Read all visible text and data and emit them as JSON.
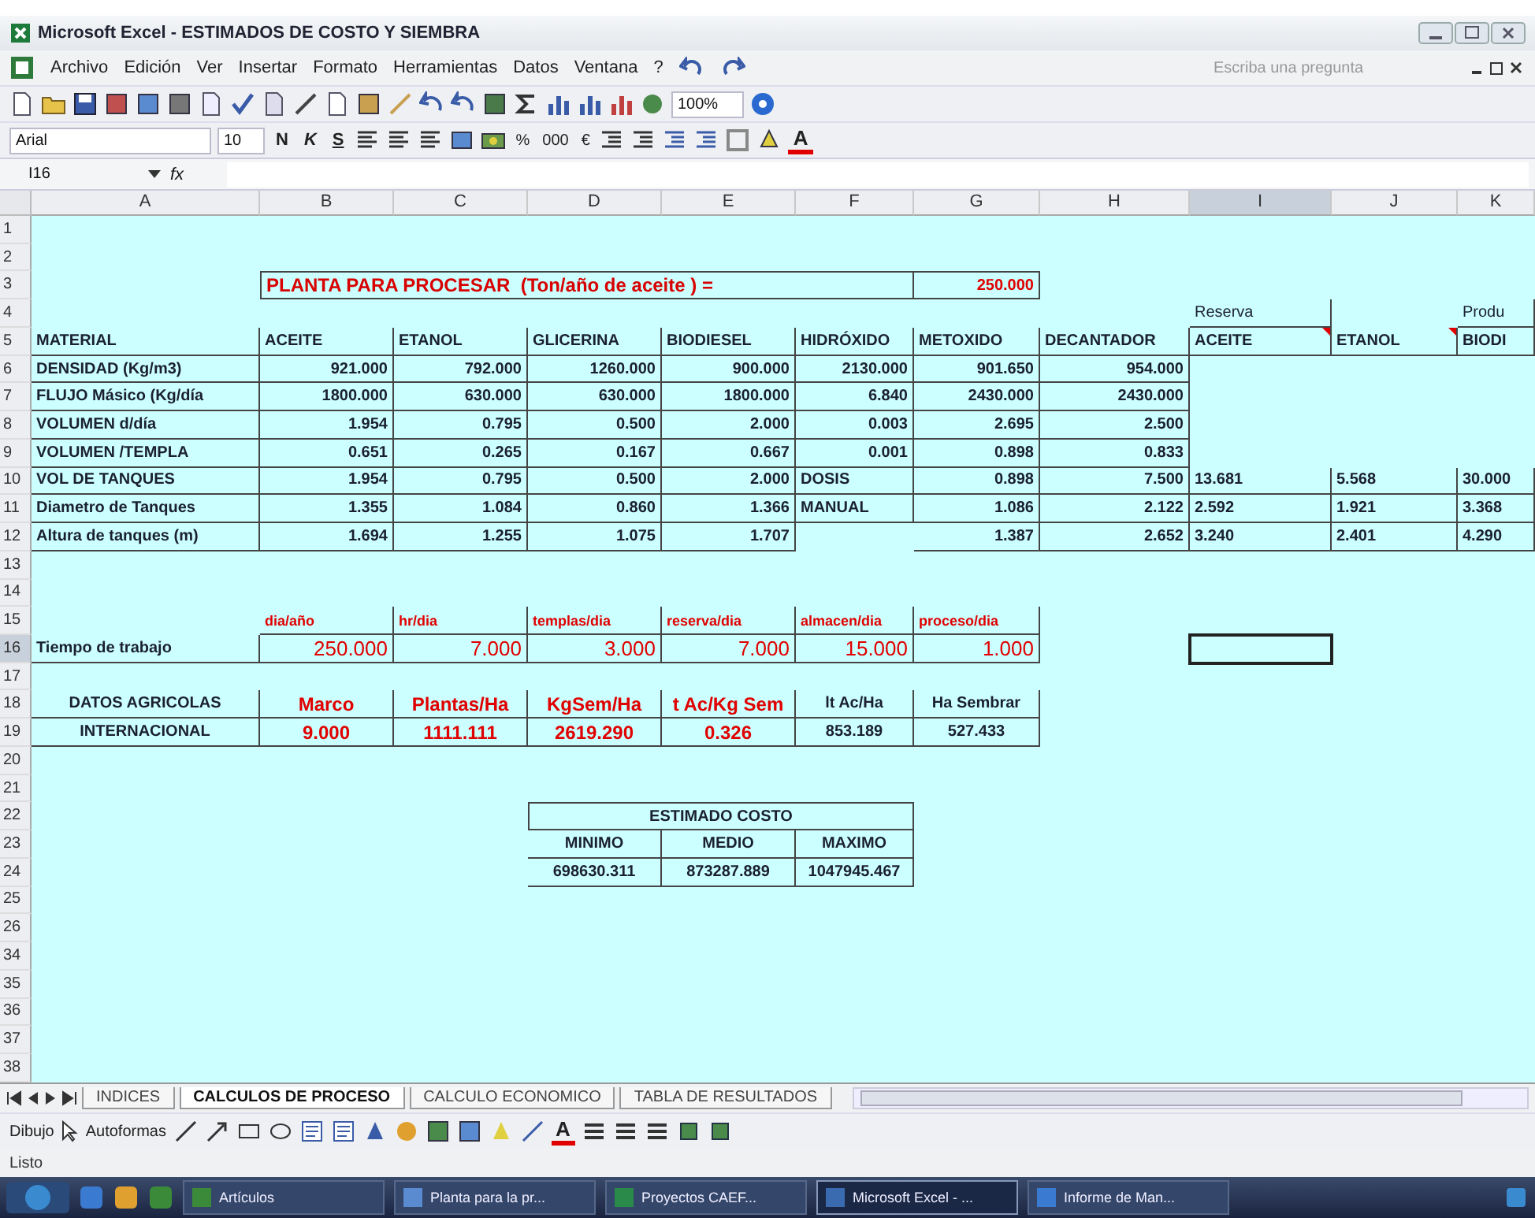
{
  "window": {
    "title": "Microsoft Excel - ESTIMADOS DE COSTO Y SIEMBRA"
  },
  "menu": [
    {
      "label": "Archivo"
    },
    {
      "label": "Edición"
    },
    {
      "label": "Ver"
    },
    {
      "label": "Insertar"
    },
    {
      "label": "Formato"
    },
    {
      "label": "Herramientas"
    },
    {
      "label": "Datos"
    },
    {
      "label": "Ventana"
    },
    {
      "label": "?"
    }
  ],
  "help_box": {
    "placeholder": "Escriba una pregunta"
  },
  "standard_toolbar": {
    "zoom": "100%"
  },
  "formatting_toolbar": {
    "font": "Arial",
    "size": "10",
    "buttons": [
      {
        "label": "N",
        "kind": "bold"
      },
      {
        "label": "K",
        "kind": "italic"
      },
      {
        "label": "S",
        "kind": "underline"
      }
    ],
    "number_buttons": [
      "%",
      "000",
      "€"
    ],
    "font_color": "A"
  },
  "formula_bar": {
    "name_box": "I16",
    "fx": "fx"
  },
  "sheet": {
    "columns": [
      {
        "label": "A",
        "selected": false
      },
      {
        "label": "B",
        "selected": false
      },
      {
        "label": "C",
        "selected": false
      },
      {
        "label": "D",
        "selected": false
      },
      {
        "label": "E",
        "selected": false
      },
      {
        "label": "F",
        "selected": false
      },
      {
        "label": "G",
        "selected": false
      },
      {
        "label": "H",
        "selected": false
      },
      {
        "label": "I",
        "selected": true
      },
      {
        "label": "J",
        "selected": false
      },
      {
        "label": "K",
        "selected": false
      }
    ],
    "rows": [
      {
        "number": "1",
        "selected": false,
        "cells": []
      },
      {
        "number": "2",
        "selected": false,
        "cells": []
      },
      {
        "number": "3",
        "selected": false,
        "cells": [
          {},
          {
            "text": "PLANTA PARA PROCESAR  (Ton/año de aceite ) =",
            "kind": "title"
          },
          {},
          {},
          {},
          {},
          {
            "text": "250.000",
            "kind": "red-small-number"
          }
        ]
      },
      {
        "number": "4",
        "selected": false,
        "cells": [
          {},
          {},
          {},
          {},
          {},
          {},
          {},
          {},
          {
            "text": "Reserva",
            "kind": "plain"
          },
          {},
          {
            "text": "Produ",
            "kind": "plain"
          }
        ]
      },
      {
        "number": "5",
        "selected": false,
        "cells": [
          {
            "text": "MATERIAL",
            "kind": "label"
          },
          {
            "text": "ACEITE",
            "kind": "label"
          },
          {
            "text": "ETANOL",
            "kind": "label"
          },
          {
            "text": "GLICERINA",
            "kind": "label"
          },
          {
            "text": "BIODIESEL",
            "kind": "label"
          },
          {
            "text": "HIDRÓXIDO",
            "kind": "label"
          },
          {
            "text": "METOXIDO",
            "kind": "label"
          },
          {
            "text": "DECANTADOR",
            "kind": "label"
          },
          {
            "text": "ACEITE",
            "kind": "label",
            "comment": true
          },
          {
            "text": "ETANOL",
            "kind": "label",
            "comment": true
          },
          {
            "text": "BIODI",
            "kind": "label"
          }
        ]
      },
      {
        "number": "6",
        "selected": false,
        "cells": [
          {
            "text": "DENSIDAD (Kg/m3)",
            "kind": "label"
          },
          {
            "text": "921.000",
            "kind": "number"
          },
          {
            "text": "792.000",
            "kind": "number"
          },
          {
            "text": "1260.000",
            "kind": "number"
          },
          {
            "text": "900.000",
            "kind": "number"
          },
          {
            "text": "2130.000",
            "kind": "number"
          },
          {
            "text": "901.650",
            "kind": "number"
          },
          {
            "text": "954.000",
            "kind": "number"
          }
        ]
      },
      {
        "number": "7",
        "selected": false,
        "cells": [
          {
            "text": "FLUJO Másico (Kg/día",
            "kind": "label"
          },
          {
            "text": "1800.000",
            "kind": "number"
          },
          {
            "text": "630.000",
            "kind": "number"
          },
          {
            "text": "630.000",
            "kind": "number"
          },
          {
            "text": "1800.000",
            "kind": "number"
          },
          {
            "text": "6.840",
            "kind": "number"
          },
          {
            "text": "2430.000",
            "kind": "number"
          },
          {
            "text": "2430.000",
            "kind": "number"
          }
        ]
      },
      {
        "number": "8",
        "selected": false,
        "cells": [
          {
            "text": "VOLUMEN d/día",
            "kind": "label"
          },
          {
            "text": "1.954",
            "kind": "number"
          },
          {
            "text": "0.795",
            "kind": "number"
          },
          {
            "text": "0.500",
            "kind": "number"
          },
          {
            "text": "2.000",
            "kind": "number"
          },
          {
            "text": "0.003",
            "kind": "number"
          },
          {
            "text": "2.695",
            "kind": "number"
          },
          {
            "text": "2.500",
            "kind": "number"
          }
        ]
      },
      {
        "number": "9",
        "selected": false,
        "cells": [
          {
            "text": "VOLUMEN /TEMPLA",
            "kind": "label"
          },
          {
            "text": "0.651",
            "kind": "number"
          },
          {
            "text": "0.265",
            "kind": "number"
          },
          {
            "text": "0.167",
            "kind": "number"
          },
          {
            "text": "0.667",
            "kind": "number"
          },
          {
            "text": "0.001",
            "kind": "number"
          },
          {
            "text": "0.898",
            "kind": "number"
          },
          {
            "text": "0.833",
            "kind": "number"
          }
        ]
      },
      {
        "number": "10",
        "selected": false,
        "cells": [
          {
            "text": "VOL DE TANQUES",
            "kind": "label"
          },
          {
            "text": "1.954",
            "kind": "number"
          },
          {
            "text": "0.795",
            "kind": "number"
          },
          {
            "text": "0.500",
            "kind": "number"
          },
          {
            "text": "2.000",
            "kind": "number"
          },
          {
            "text": "DOSIS",
            "kind": "label"
          },
          {
            "text": "0.898",
            "kind": "number"
          },
          {
            "text": "7.500",
            "kind": "number"
          },
          {
            "text": "13.681",
            "kind": "label"
          },
          {
            "text": "5.568",
            "kind": "label"
          },
          {
            "text": "30.000",
            "kind": "label"
          }
        ]
      },
      {
        "number": "11",
        "selected": false,
        "cells": [
          {
            "text": "Diametro de Tanques",
            "kind": "label"
          },
          {
            "text": "1.355",
            "kind": "number"
          },
          {
            "text": "1.084",
            "kind": "number"
          },
          {
            "text": "0.860",
            "kind": "number"
          },
          {
            "text": "1.366",
            "kind": "number"
          },
          {
            "text": "MANUAL",
            "kind": "label"
          },
          {
            "text": "1.086",
            "kind": "number"
          },
          {
            "text": "2.122",
            "kind": "number"
          },
          {
            "text": "2.592",
            "kind": "label"
          },
          {
            "text": "1.921",
            "kind": "label"
          },
          {
            "text": "3.368",
            "kind": "label"
          }
        ]
      },
      {
        "number": "12",
        "selected": false,
        "cells": [
          {
            "text": "Altura de tanques (m)",
            "kind": "label"
          },
          {
            "text": "1.694",
            "kind": "number"
          },
          {
            "text": "1.255",
            "kind": "number"
          },
          {
            "text": "1.075",
            "kind": "number"
          },
          {
            "text": "1.707",
            "kind": "number"
          },
          {},
          {
            "text": "1.387",
            "kind": "number"
          },
          {
            "text": "2.652",
            "kind": "number"
          },
          {
            "text": "3.240",
            "kind": "label"
          },
          {
            "text": "2.401",
            "kind": "label"
          },
          {
            "text": "4.290",
            "kind": "label"
          }
        ]
      },
      {
        "number": "13",
        "selected": false,
        "cells": []
      },
      {
        "number": "14",
        "selected": false,
        "cells": []
      },
      {
        "number": "15",
        "selected": false,
        "cells": [
          {},
          {
            "text": "dia/año",
            "kind": "red-small"
          },
          {
            "text": "hr/dia",
            "kind": "red-small"
          },
          {
            "text": "templas/dia",
            "kind": "red-small"
          },
          {
            "text": "reserva/dia",
            "kind": "red-small"
          },
          {
            "text": "almacen/dia",
            "kind": "red-small"
          },
          {
            "text": "proceso/dia",
            "kind": "red-small"
          }
        ]
      },
      {
        "number": "16",
        "selected": true,
        "cells": [
          {
            "text": "Tiempo de trabajo",
            "kind": "label"
          },
          {
            "text": "250.000",
            "kind": "red-number"
          },
          {
            "text": "7.000",
            "kind": "red-number"
          },
          {
            "text": "3.000",
            "kind": "red-number"
          },
          {
            "text": "7.000",
            "kind": "red-number"
          },
          {
            "text": "15.000",
            "kind": "red-number"
          },
          {
            "text": "1.000",
            "kind": "red-number"
          }
        ]
      },
      {
        "number": "17",
        "selected": false,
        "cells": []
      },
      {
        "number": "18",
        "selected": false,
        "cells": [
          {
            "text": "DATOS AGRICOLAS",
            "kind": "center"
          },
          {
            "text": "Marco",
            "kind": "red-center"
          },
          {
            "text": "Plantas/Ha",
            "kind": "red-center"
          },
          {
            "text": "KgSem/Ha",
            "kind": "red-center"
          },
          {
            "text": "t Ac/Kg Sem",
            "kind": "red-center"
          },
          {
            "text": "lt Ac/Ha",
            "kind": "center"
          },
          {
            "text": "Ha Sembrar",
            "kind": "center"
          }
        ]
      },
      {
        "number": "19",
        "selected": false,
        "cells": [
          {
            "text": "INTERNACIONAL",
            "kind": "center"
          },
          {
            "text": "9.000",
            "kind": "red-center"
          },
          {
            "text": "1111.111",
            "kind": "red-center"
          },
          {
            "text": "2619.290",
            "kind": "red-center"
          },
          {
            "text": "0.326",
            "kind": "red-center"
          },
          {
            "text": "853.189",
            "kind": "center"
          },
          {
            "text": "527.433",
            "kind": "center"
          }
        ]
      },
      {
        "number": "20",
        "selected": false,
        "cells": []
      },
      {
        "number": "21",
        "selected": false,
        "cells": []
      },
      {
        "number": "22",
        "selected": false,
        "cells": [
          {},
          {},
          {},
          {
            "text": "ESTIMADO COSTO",
            "kind": "caption"
          }
        ]
      },
      {
        "number": "23",
        "selected": false,
        "cells": [
          {},
          {},
          {},
          {
            "text": "MINIMO",
            "kind": "box-center"
          },
          {
            "text": "MEDIO",
            "kind": "box-center"
          },
          {
            "text": "MAXIMO",
            "kind": "box-center"
          }
        ]
      },
      {
        "number": "24",
        "selected": false,
        "cells": [
          {},
          {},
          {},
          {
            "text": "698630.311",
            "kind": "box-center"
          },
          {
            "text": "873287.889",
            "kind": "box-center"
          },
          {
            "text": "1047945.467",
            "kind": "box-center"
          }
        ]
      },
      {
        "number": "25",
        "selected": false,
        "cells": []
      },
      {
        "number": "26",
        "selected": false,
        "cells": []
      },
      {
        "number": "34",
        "selected": false,
        "cells": []
      },
      {
        "number": "35",
        "selected": false,
        "cells": []
      },
      {
        "number": "36",
        "selected": false,
        "cells": []
      },
      {
        "number": "37",
        "selected": false,
        "cells": []
      },
      {
        "number": "38",
        "selected": false,
        "cells": []
      }
    ]
  },
  "sheet_tabs": [
    {
      "label": "INDICES",
      "selected": false
    },
    {
      "label": "CALCULOS DE PROCESO",
      "selected": true
    },
    {
      "label": "CALCULO ECONOMICO",
      "selected": false
    },
    {
      "label": "TABLA DE RESULTADOS",
      "selected": false
    }
  ],
  "drawing_toolbar": {
    "draw_menu": "Dibujo",
    "autoshapes_menu": "Autoformas",
    "font_color": "A"
  },
  "status_bar": {
    "text": "Listo"
  },
  "taskbar": {
    "items": [
      {
        "label": "Artículos",
        "selected": false
      },
      {
        "label": "Planta para la pr...",
        "selected": false
      },
      {
        "label": "Proyectos CAEF...",
        "selected": false
      },
      {
        "label": "Microsoft Excel - ...",
        "selected": true
      },
      {
        "label": "Informe de Man...",
        "selected": false
      }
    ]
  }
}
